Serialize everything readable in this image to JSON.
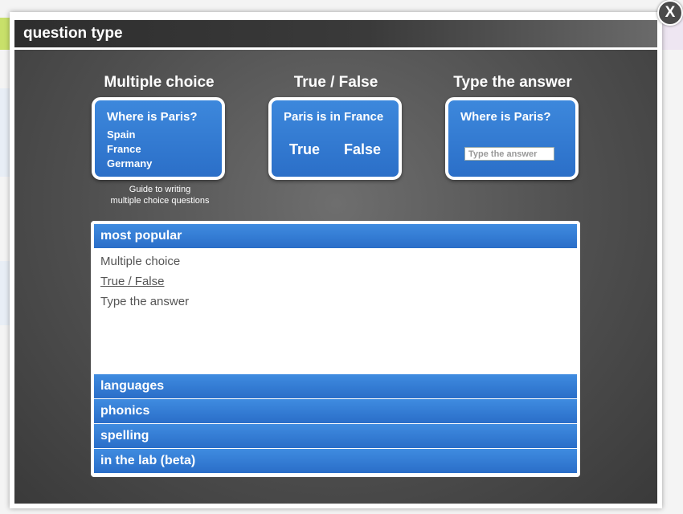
{
  "dialog": {
    "title": "question type",
    "close_label": "X"
  },
  "question_types": [
    {
      "heading": "Multiple choice",
      "card_question": "Where is Paris?",
      "options": [
        "Spain",
        "France",
        "Germany"
      ]
    },
    {
      "heading": "True / False",
      "card_question": "Paris is in France",
      "true_label": "True",
      "false_label": "False"
    },
    {
      "heading": "Type the answer",
      "card_question": "Where is Paris?",
      "input_placeholder": "Type the answer"
    }
  ],
  "guide_link": {
    "line1": "Guide to writing",
    "line2": "multiple choice questions"
  },
  "categories": {
    "most_popular": {
      "label": "most popular",
      "items": [
        "Multiple choice",
        "True / False",
        "Type the answer"
      ]
    },
    "languages": "languages",
    "phonics": "phonics",
    "spelling": "spelling",
    "lab": "in the lab (beta)"
  },
  "colors": {
    "accent_blue": "#2b6fc8",
    "dialog_dark": "#3a3a3a"
  }
}
